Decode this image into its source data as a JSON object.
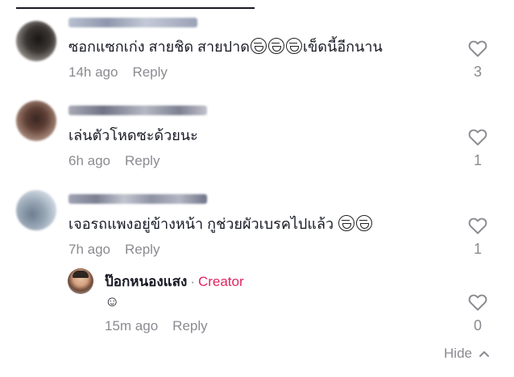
{
  "comments": [
    {
      "text": "ซอกแซกเก่ง สายชิด สายปาด",
      "text_suffix": "เข็ดนี้อีกนาน",
      "emoji_count": 3,
      "time": "14h ago",
      "reply_label": "Reply",
      "likes": "3"
    },
    {
      "text": "เล่นตัวโหดซะด้วยนะ",
      "time": "6h ago",
      "reply_label": "Reply",
      "likes": "1"
    },
    {
      "text": "เจอรถแพงอยู่ข้างหน้า กูช่วยผัวเบรคไปแล้ว",
      "emoji_count": 2,
      "time": "7h ago",
      "reply_label": "Reply",
      "likes": "1"
    }
  ],
  "reply": {
    "author": "ป๊อกหนองแสง",
    "separator": "·",
    "badge": "Creator",
    "text": "☺",
    "time": "15m ago",
    "reply_label": "Reply",
    "likes": "0"
  },
  "footer": {
    "hide_label": "Hide"
  },
  "icons": {
    "like": "heart-outline-icon",
    "hide": "chevron-up-icon",
    "emoji": "laughing-face-icon"
  },
  "colors": {
    "text": "#161823",
    "muted": "#8a8b91",
    "creator": "#e0245e"
  }
}
